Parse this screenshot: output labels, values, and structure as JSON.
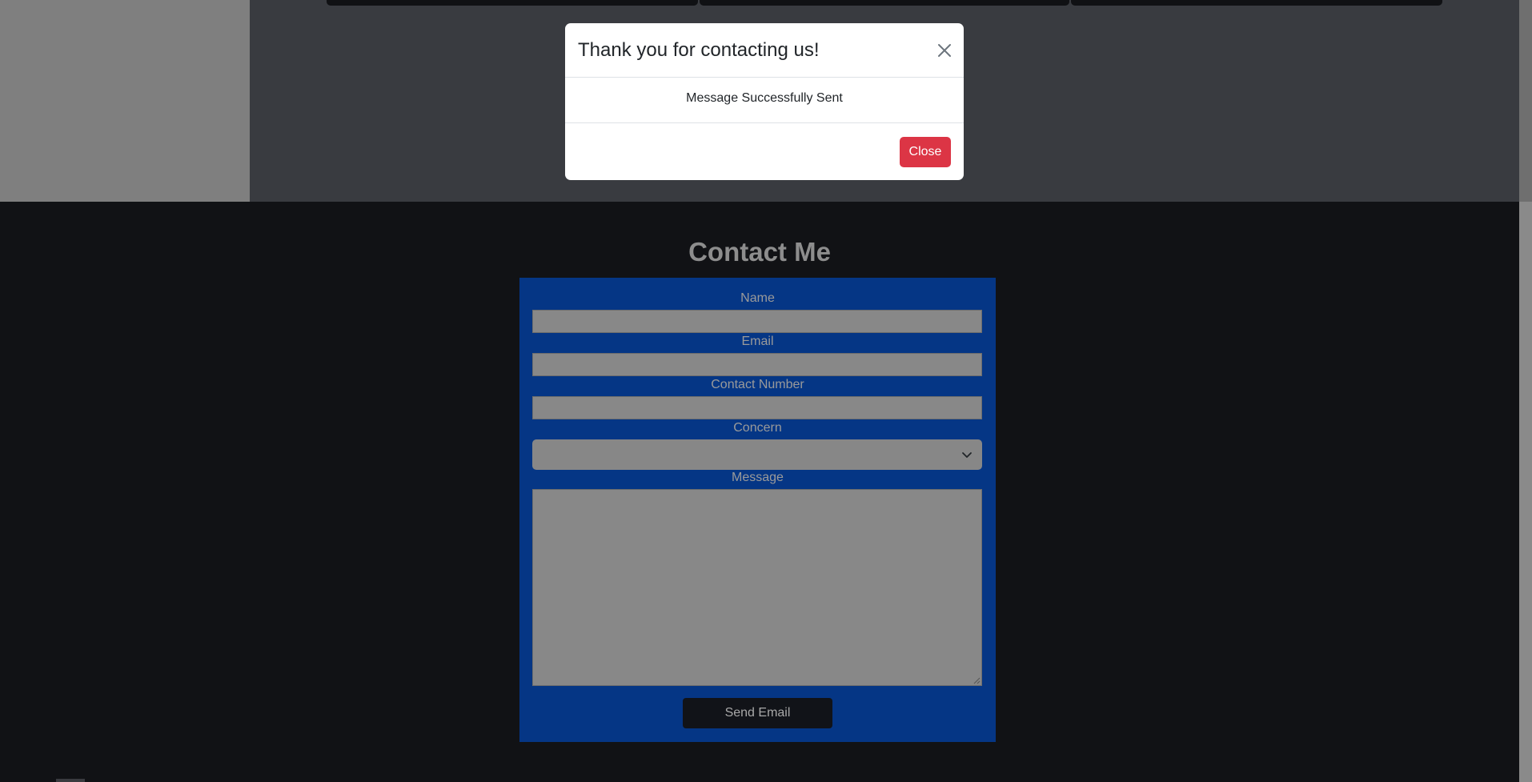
{
  "modal": {
    "title": "Thank you for contacting us!",
    "message": "Message Successfully Sent",
    "close_button_label": "Close",
    "close_icon": "close-icon"
  },
  "contact": {
    "title": "Contact Me",
    "fields": {
      "name": {
        "label": "Name",
        "value": ""
      },
      "email": {
        "label": "Email",
        "value": ""
      },
      "contact_number": {
        "label": "Contact Number",
        "value": ""
      },
      "concern": {
        "label": "Concern",
        "selected": "",
        "icon": "chevron-down-icon"
      },
      "message": {
        "label": "Message",
        "value": ""
      }
    },
    "send_button_label": "Send Email"
  },
  "colors": {
    "modal_close_button": "#dc3545",
    "form_panel": "#053685",
    "page_background": "#111215",
    "backdrop_main": "#393b40",
    "backdrop_left": "#7f7f7f"
  }
}
